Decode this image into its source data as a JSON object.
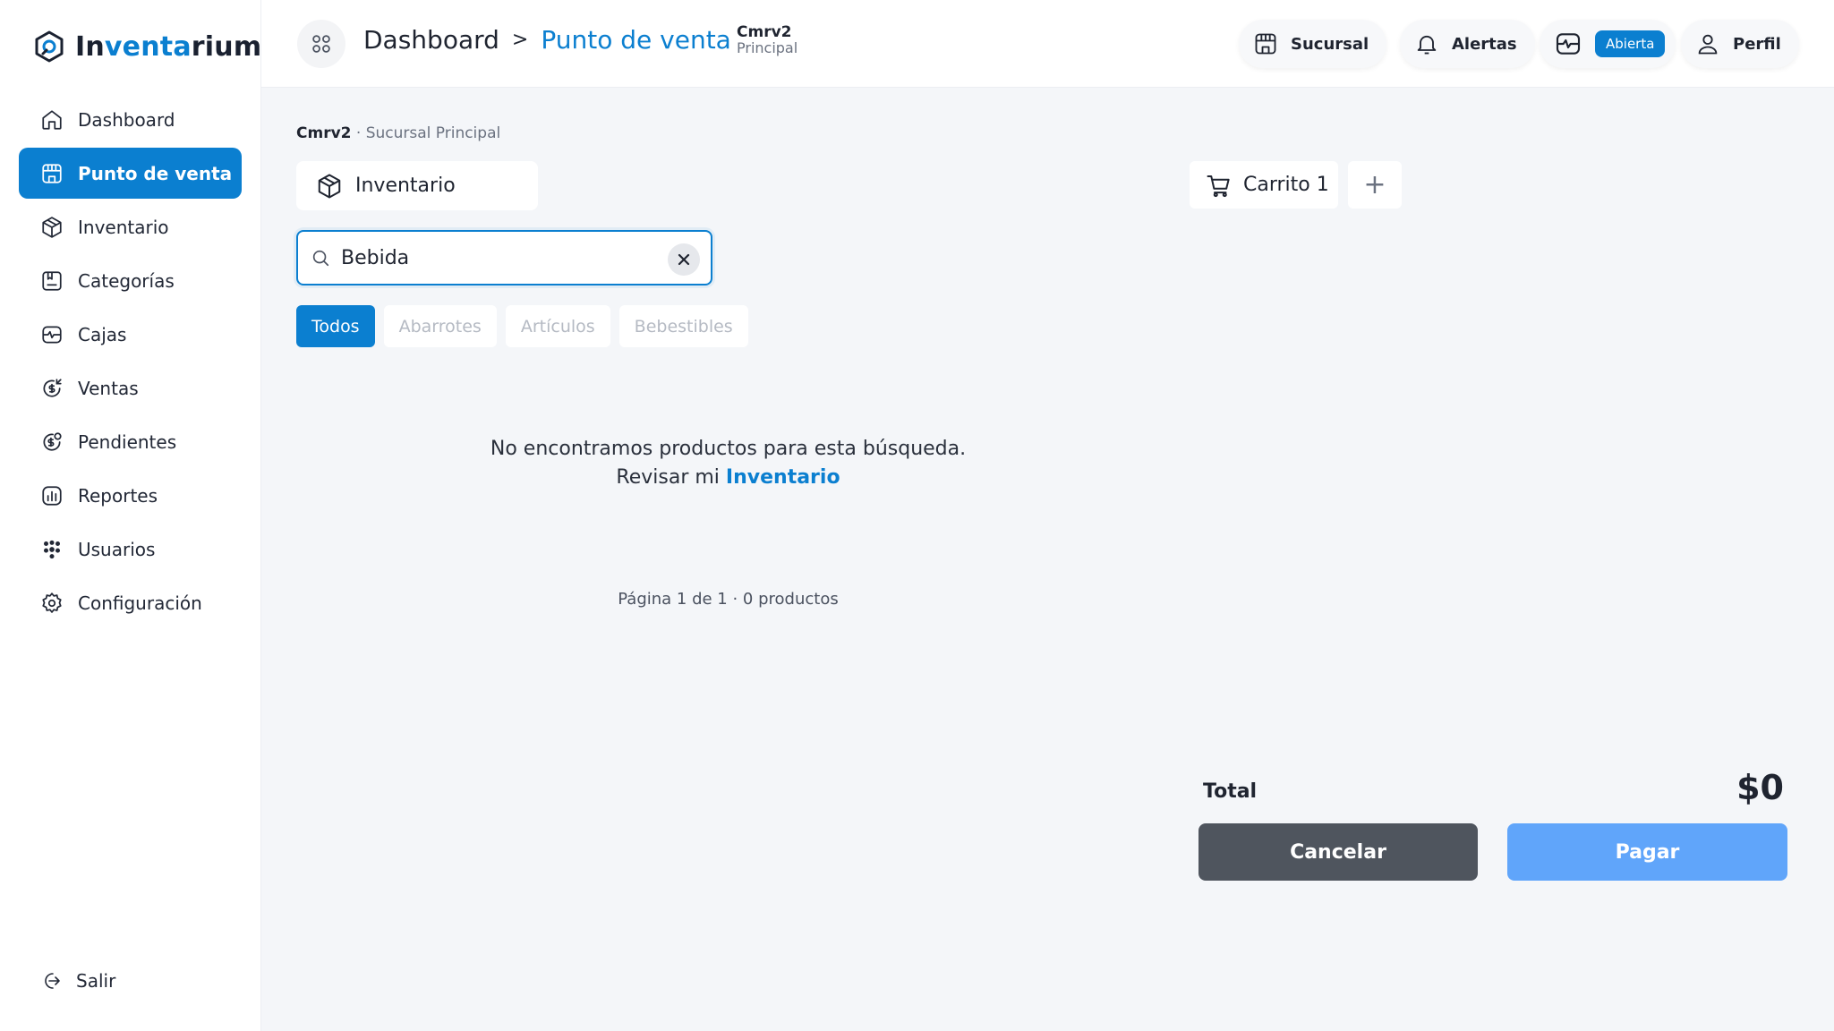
{
  "app": {
    "logo_prefix": "In",
    "logo_accent": "venta",
    "logo_suffix": "rium"
  },
  "sidebar": {
    "items": [
      {
        "label": "Dashboard",
        "icon": "home-icon"
      },
      {
        "label": "Punto de venta",
        "icon": "store-icon",
        "active": true
      },
      {
        "label": "Inventario",
        "icon": "box-icon"
      },
      {
        "label": "Categorías",
        "icon": "category-icon"
      },
      {
        "label": "Cajas",
        "icon": "cash-register-icon"
      },
      {
        "label": "Ventas",
        "icon": "sales-icon"
      },
      {
        "label": "Pendientes",
        "icon": "pending-icon"
      },
      {
        "label": "Reportes",
        "icon": "reports-icon"
      },
      {
        "label": "Usuarios",
        "icon": "users-icon"
      },
      {
        "label": "Configuración",
        "icon": "settings-icon"
      }
    ],
    "logout_label": "Salir"
  },
  "topbar": {
    "breadcrumb": {
      "root": "Dashboard",
      "separator": ">",
      "current": "Punto de venta"
    },
    "branch": {
      "name": "Cmrv2",
      "sub": "Principal"
    },
    "sucursal_label": "Sucursal",
    "alertas_label": "Alertas",
    "caja_status": "Abierta",
    "perfil_label": "Perfil"
  },
  "main": {
    "store_name": "Cmrv2",
    "store_sub": "· Sucursal Principal",
    "inventory_tab": "Inventario",
    "search": {
      "value": "Bebida",
      "placeholder": ""
    },
    "filters": [
      "Todos",
      "Abarrotes",
      "Artículos",
      "Bebestibles"
    ],
    "active_filter": "Todos",
    "empty_message": "No encontramos productos para esta búsqueda.",
    "review_prefix": "Revisar mi",
    "review_link": "Inventario",
    "page_info": "Página 1 de 1 · 0 productos"
  },
  "cart": {
    "tab_label": "Carrito 1",
    "add_label": "+",
    "total_label": "Total",
    "total_value": "$0",
    "cancel_label": "Cancelar",
    "pay_label": "Pagar"
  },
  "colors": {
    "accent": "#0b7fd0",
    "pay_button": "#60a5fa",
    "cancel_button": "#4f555e"
  }
}
